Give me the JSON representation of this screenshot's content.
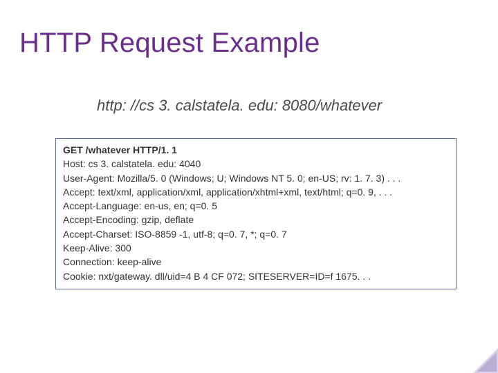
{
  "title": "HTTP Request Example",
  "url_line": "http: //cs 3. calstatela. edu: 8080/whatever",
  "request": {
    "first_line": "GET /whatever HTTP/1. 1",
    "headers": [
      "Host: cs 3. calstatela. edu: 4040",
      "User-Agent: Mozilla/5. 0 (Windows; U; Windows NT 5. 0; en-US; rv: 1. 7. 3) . . .",
      "Accept: text/xml, application/xml, application/xhtml+xml, text/html; q=0. 9, . . .",
      "Accept-Language: en-us, en; q=0. 5",
      "Accept-Encoding: gzip, deflate",
      "Accept-Charset: ISO-8859 -1, utf-8; q=0. 7, *; q=0. 7",
      "Keep-Alive: 300",
      "Connection: keep-alive",
      "Cookie: nxt/gateway. dll/uid=4 B 4 CF 072; SITESERVER=ID=f 1675. . ."
    ]
  }
}
